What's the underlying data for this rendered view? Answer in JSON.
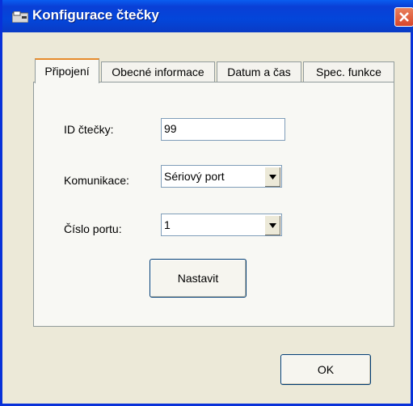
{
  "window": {
    "title": "Konfigurace čtečky"
  },
  "tabs": [
    {
      "label": "Připojení",
      "active": true
    },
    {
      "label": "Obecné informace",
      "active": false
    },
    {
      "label": "Datum a čas",
      "active": false
    },
    {
      "label": "Spec. funkce",
      "active": false
    }
  ],
  "form": {
    "reader_id_label": "ID čtečky:",
    "reader_id_value": "99",
    "communication_label": "Komunikace:",
    "communication_value": "Sériový port",
    "port_label": "Číslo portu:",
    "port_value": "1",
    "set_button": "Nastavit"
  },
  "footer": {
    "ok_button": "OK"
  },
  "colors": {
    "titlebar": "#0a3fd6",
    "active_tab_accent": "#e68b2c",
    "close_button": "#d7462b"
  }
}
